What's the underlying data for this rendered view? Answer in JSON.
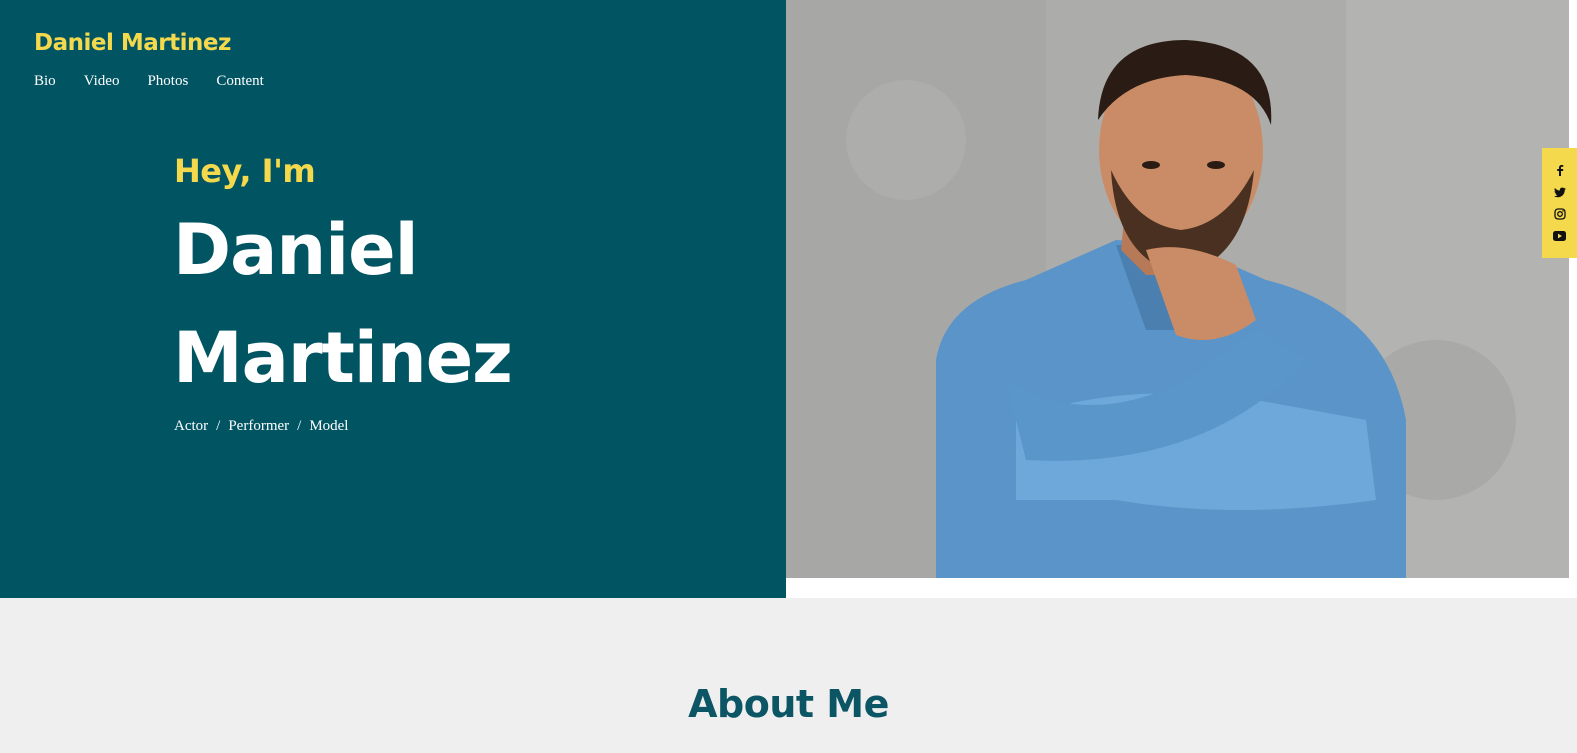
{
  "header": {
    "brand": "Daniel Martinez",
    "nav": [
      "Bio",
      "Video",
      "Photos",
      "Content"
    ]
  },
  "hero": {
    "greeting": "Hey, I'm",
    "first_name": "Daniel",
    "last_name": "Martinez",
    "roles": [
      "Actor",
      "Performer",
      "Model"
    ],
    "role_separator": "/",
    "photo_icon": "portrait-photo"
  },
  "social": {
    "icons": [
      "facebook-icon",
      "twitter-icon",
      "instagram-icon",
      "youtube-icon"
    ]
  },
  "about": {
    "title": "About Me"
  },
  "colors": {
    "teal": "#015563",
    "yellow": "#f5d94d",
    "about_heading": "#0b5564",
    "page_bg": "#efefef"
  }
}
